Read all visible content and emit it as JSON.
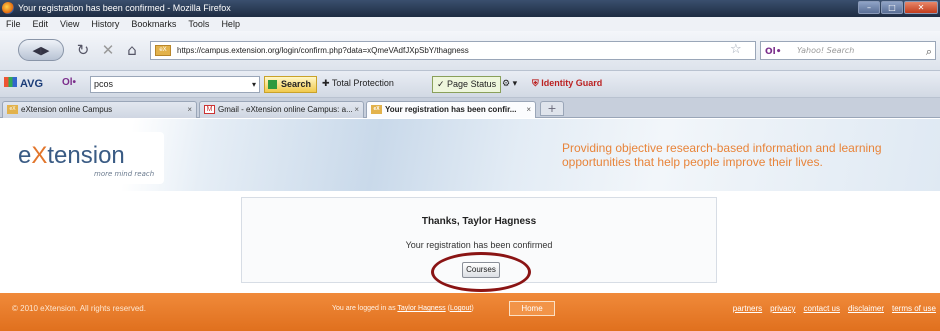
{
  "window": {
    "title": "Your registration has been confirmed - Mozilla Firefox",
    "min": "–",
    "max": "□",
    "close": "✕"
  },
  "menu": [
    "File",
    "Edit",
    "View",
    "History",
    "Bookmarks",
    "Tools",
    "Help"
  ],
  "nav": {
    "url": "https://campus.extension.org/login/confirm.php?data=xQmeVAdfJXpSbY/thagness",
    "search_engine": "Ol•",
    "search_placeholder": "Yahoo! Search"
  },
  "avg": {
    "logo": "AVG",
    "ol": "Ol•",
    "query": "pcos",
    "search_label": "Search",
    "total_protection": "Total Protection",
    "page_status": "Page Status",
    "identity_guard": "Identity Guard"
  },
  "tabs": [
    {
      "label": "eXtension online Campus",
      "icon": "extension-favicon"
    },
    {
      "label": "Gmail - eXtension online Campus: a...",
      "icon": "gmail-icon"
    },
    {
      "label": "Your registration has been confir...",
      "icon": "extension-favicon",
      "active": true
    }
  ],
  "header": {
    "logo_e": "e",
    "logo_x": "X",
    "logo_rest": "tension",
    "logo_tag": "more mind reach",
    "tagline": "Providing objective research-based information and learning opportunities that help people improve their lives."
  },
  "confirm": {
    "thanks": "Thanks, Taylor Hagness",
    "message": "Your registration has been confirmed",
    "button": "Courses"
  },
  "footer": {
    "copyright": "© 2010 eXtension. All rights reserved.",
    "logged_in_prefix": "You are logged in as",
    "user": "Taylor Hagness",
    "logout": "Logout",
    "home": "Home",
    "links": [
      "partners",
      "privacy",
      "contact us",
      "disclaimer",
      "terms of use"
    ]
  },
  "colors": {
    "footer": "#e0701e",
    "tagline": "#e8843a",
    "annotation_circle": "#8a1414"
  }
}
